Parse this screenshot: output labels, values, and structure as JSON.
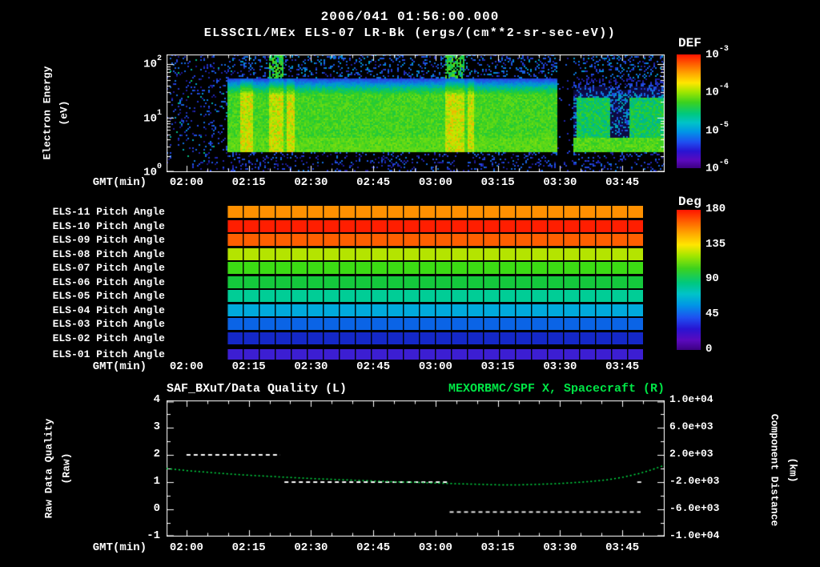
{
  "header": {
    "title": "2006/041 01:56:00.000",
    "subtitle": "ELSSCIL/MEx ELS-07 LR-Bk  (ergs/(cm**2-sr-sec-eV))"
  },
  "time_axis": {
    "label": "GMT(min)",
    "ticks": [
      "02:00",
      "02:15",
      "02:30",
      "02:45",
      "03:00",
      "03:15",
      "03:30",
      "03:45"
    ],
    "start_offset_min": 4.8,
    "step_min": 15,
    "minutes_total": 120
  },
  "top_panel": {
    "ylabel_line1": "Electron Energy",
    "ylabel_line2": "(eV)",
    "yticks": [
      {
        "base": "10",
        "exp": "2"
      },
      {
        "base": "10",
        "exp": "1"
      },
      {
        "base": "10",
        "exp": "0"
      }
    ],
    "colorbar": {
      "title": "DEF",
      "ticks": [
        {
          "base": "10",
          "exp": "-3"
        },
        {
          "base": "10",
          "exp": "-4"
        },
        {
          "base": "10",
          "exp": "-5"
        },
        {
          "base": "10",
          "exp": "-6"
        }
      ]
    }
  },
  "pitch_panel": {
    "colorbar": {
      "title": "Deg",
      "ticks": [
        "180",
        "135",
        "90",
        "45",
        "0"
      ]
    },
    "segments": 26,
    "bar_t_range_min": [
      14.5,
      114.8
    ],
    "rows": [
      {
        "label": "ELS-11 Pitch Angle",
        "angle_deg": 152,
        "color": "#ff9000"
      },
      {
        "label": "ELS-10 Pitch Angle",
        "angle_deg": 176,
        "color": "#ff1e00"
      },
      {
        "label": "ELS-09 Pitch Angle",
        "angle_deg": 163,
        "color": "#ff5f00"
      },
      {
        "label": "ELS-08 Pitch Angle",
        "angle_deg": 124,
        "color": "#b4e400"
      },
      {
        "label": "ELS-07 Pitch Angle",
        "angle_deg": 104,
        "color": "#3cdc14"
      },
      {
        "label": "ELS-06 Pitch Angle",
        "angle_deg": 94,
        "color": "#14c83c"
      },
      {
        "label": "ELS-05 Pitch Angle",
        "angle_deg": 78,
        "color": "#00cd96"
      },
      {
        "label": "ELS-04 Pitch Angle",
        "angle_deg": 60,
        "color": "#00aadc"
      },
      {
        "label": "ELS-03 Pitch Angle",
        "angle_deg": 44,
        "color": "#0a64e6"
      },
      {
        "label": "ELS-02 Pitch Angle",
        "angle_deg": 26,
        "color": "#1428c8"
      },
      {
        "label": "ELS-01 Pitch Angle",
        "angle_deg": 8,
        "color": "#3c1ed2"
      }
    ]
  },
  "bottom_panel": {
    "title_left": "SAF_BXuT/Data Quality (L)",
    "title_right": "MEXORBMC/SPF X, Spacecraft (R)",
    "title_right_color": "#00e646",
    "left_axis": {
      "label_line1": "Raw Data Quality",
      "label_line2": "(Raw)",
      "ticks": [
        "4",
        "3",
        "2",
        "1",
        "0",
        "-1"
      ],
      "min": -1,
      "max": 4
    },
    "right_axis": {
      "label_line1": "Component Distance",
      "label_line2": "(km)",
      "ticks": [
        "1.0e+04",
        "6.0e+03",
        "2.0e+03",
        "-2.0e+03",
        "-6.0e+03",
        "-1.0e+04"
      ],
      "min": -10000,
      "max": 10000
    }
  },
  "chart_data": [
    {
      "type": "heatmap",
      "name": "electron-energy-spectrogram",
      "title": "ELSSCIL/MEx ELS-07 LR-Bk",
      "units": "ergs/(cm**2-sr-sec-eV)",
      "x_range_gmt": [
        "01:56",
        "03:56"
      ],
      "y_range_ev": [
        1,
        150
      ],
      "y_scale": "log",
      "z_label": "DEF",
      "z_range": [
        1e-06,
        0.001
      ],
      "features": {
        "data_start_min": 14.5,
        "main_band_ev": [
          2.5,
          55
        ],
        "bright_columns_min": [
          [
            17.5,
            20.5
          ],
          [
            24.5,
            28
          ],
          [
            28.7,
            30.5
          ],
          [
            67,
            71.5
          ],
          [
            72.5,
            74
          ]
        ],
        "tall_columns_min": [
          [
            24.5,
            28
          ],
          [
            67,
            71.5
          ]
        ],
        "dropout_min": [
          93.8,
          97.8
        ],
        "post_patches_min": [
          [
            98.5,
            106.5
          ],
          [
            111.5,
            120
          ]
        ]
      }
    },
    {
      "type": "heatmap",
      "name": "pitch-angle-panels",
      "color_scale": {
        "label": "Deg",
        "min": 0,
        "max": 180
      },
      "rows": [
        {
          "detector": "ELS-11",
          "pitch_angle_deg": 152
        },
        {
          "detector": "ELS-10",
          "pitch_angle_deg": 176
        },
        {
          "detector": "ELS-09",
          "pitch_angle_deg": 163
        },
        {
          "detector": "ELS-08",
          "pitch_angle_deg": 124
        },
        {
          "detector": "ELS-07",
          "pitch_angle_deg": 104
        },
        {
          "detector": "ELS-06",
          "pitch_angle_deg": 94
        },
        {
          "detector": "ELS-05",
          "pitch_angle_deg": 78
        },
        {
          "detector": "ELS-04",
          "pitch_angle_deg": 60
        },
        {
          "detector": "ELS-03",
          "pitch_angle_deg": 44
        },
        {
          "detector": "ELS-02",
          "pitch_angle_deg": 26
        },
        {
          "detector": "ELS-01",
          "pitch_angle_deg": 8
        }
      ]
    },
    {
      "type": "line",
      "name": "data-quality-and-spacecraft-x",
      "left_ylim": [
        -1,
        4
      ],
      "right_ylim": [
        -10000,
        10000
      ],
      "series": [
        {
          "name": "SAF_BXuT/Data Quality",
          "axis": "left",
          "color": "#ffffff",
          "style": "dashed",
          "segments": [
            {
              "t_min": [
                4.8,
                27.4
              ],
              "value": 2
            },
            {
              "t_min": [
                28.4,
                67.9
              ],
              "value": 1
            },
            {
              "t_min": [
                68.2,
                114.2
              ],
              "value": -0.1
            },
            {
              "t_min": [
                113.4,
                114.8
              ],
              "value": 1
            }
          ]
        },
        {
          "name": "MEXORBMC/SPF X",
          "axis": "right",
          "color": "#00e646",
          "style": "dotted",
          "points_t_km": [
            [
              0,
              0
            ],
            [
              5,
              -320
            ],
            [
              10,
              -560
            ],
            [
              15,
              -800
            ],
            [
              20,
              -1000
            ],
            [
              25,
              -1160
            ],
            [
              30,
              -1320
            ],
            [
              35,
              -1480
            ],
            [
              40,
              -1600
            ],
            [
              45,
              -1720
            ],
            [
              50,
              -1840
            ],
            [
              55,
              -1960
            ],
            [
              60,
              -2040
            ],
            [
              65,
              -2140
            ],
            [
              70,
              -2240
            ],
            [
              75,
              -2320
            ],
            [
              80,
              -2400
            ],
            [
              85,
              -2400
            ],
            [
              90,
              -2320
            ],
            [
              95,
              -2200
            ],
            [
              98,
              -2080
            ],
            [
              102,
              -1920
            ],
            [
              106,
              -1680
            ],
            [
              110,
              -1280
            ],
            [
              114,
              -720
            ],
            [
              117,
              -160
            ],
            [
              120,
              480
            ]
          ]
        }
      ]
    }
  ]
}
